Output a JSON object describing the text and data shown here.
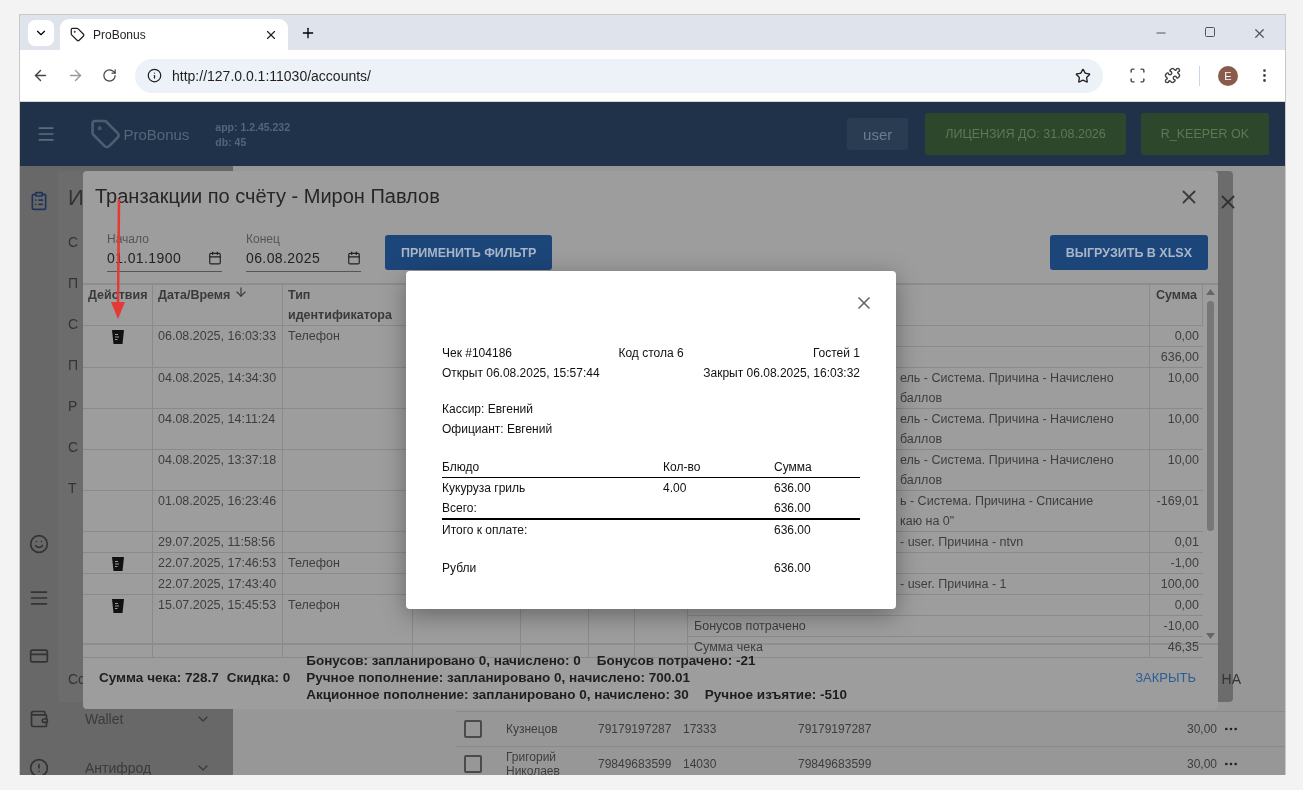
{
  "browser": {
    "tab_title": "ProBonus",
    "url": "http://127.0.0.1:11030/accounts/",
    "profile_initial": "E"
  },
  "header": {
    "brand": "ProBonus",
    "app_version": "app: 1.2.45.232",
    "db_version": "db: 45",
    "user": "user",
    "license": "ЛИЦЕНЗИЯ ДО: 31.08.2026",
    "rkeeper_status": "R_KEEPER OK"
  },
  "sidebar": {
    "items": [
      {
        "label": "Wallet",
        "expanded": false
      },
      {
        "label": "Антифрод",
        "expanded": false
      }
    ]
  },
  "background_table": {
    "rows": [
      {
        "checked": false,
        "name": "Кузнецов",
        "phone": "79179197287",
        "code": "17333",
        "card": "79179197287",
        "amount": "30,00"
      },
      {
        "checked": false,
        "name": "Григорий\nНиколаев",
        "phone": "79849683599",
        "code": "14030",
        "card": "79849683599",
        "amount": "30,00"
      }
    ]
  },
  "back_dialog": {
    "title_fragment": "И",
    "item_fragments": [
      "С",
      "П",
      "С",
      "П",
      "Р",
      "С",
      "Т"
    ],
    "footer_fragment": "Со",
    "footer_right_fragment": "НА"
  },
  "dialog": {
    "title": "Транзакции по счёту - Мирон Павлов",
    "filters": [
      {
        "label": "Начало",
        "value": "01.01.1900"
      },
      {
        "label": "Конец",
        "value": "06.08.2025"
      }
    ],
    "apply_button": "ПРИМЕНИТЬ ФИЛЬТР",
    "export_button": "ВЫГРУЗИТЬ В XLSX",
    "table": {
      "columns": [
        {
          "label": "Действия"
        },
        {
          "label": "Дата/Время",
          "sorted": true
        },
        {
          "label": "Тип идентификатора"
        },
        {
          "label": "Сумма"
        }
      ],
      "rows": [
        {
          "has_receipt": true,
          "date": "06.08.2025, 16:03:33",
          "id_type": "Телефон",
          "parts": [
            {
              "amount": "0,00"
            },
            {
              "amount": "636,00"
            }
          ]
        },
        {
          "has_receipt": false,
          "date": "04.08.2025, 14:34:30",
          "parts": [
            {
              "text": "ель - Система. Причина - Начислено\nбаллов",
              "amount": "10,00"
            }
          ]
        },
        {
          "has_receipt": false,
          "date": "04.08.2025, 14:11:24",
          "parts": [
            {
              "text": "ель - Система. Причина - Начислено\nбаллов",
              "amount": "10,00"
            }
          ]
        },
        {
          "has_receipt": false,
          "date": "04.08.2025, 13:37:18",
          "parts": [
            {
              "text": "ель - Система. Причина - Начислено\nбаллов",
              "amount": "10,00"
            }
          ]
        },
        {
          "has_receipt": false,
          "date": "01.08.2025, 16:23:46",
          "parts": [
            {
              "text": "ь - Система. Причина - Списание\nкаю на 0\"",
              "amount": "-169,01"
            }
          ]
        },
        {
          "has_receipt": false,
          "date": "29.07.2025, 11:58:56",
          "parts": [
            {
              "text": "- user. Причина - ntvn",
              "amount": "0,01"
            }
          ]
        },
        {
          "has_receipt": true,
          "date": "22.07.2025, 17:46:53",
          "id_type": "Телефон",
          "parts": [
            {
              "amount": "-1,00"
            }
          ]
        },
        {
          "has_receipt": false,
          "date": "22.07.2025, 17:43:40",
          "parts": [
            {
              "text": "- user. Причина - 1",
              "amount": "100,00"
            }
          ]
        },
        {
          "has_receipt": true,
          "date": "15.07.2025, 15:45:53",
          "id_type": "Телефон",
          "parts": [
            {
              "amount": "0,00"
            },
            {
              "text": "Бонусов потрачено",
              "amount": "-10,00"
            },
            {
              "text": "Сумма чека",
              "amount": "46,35"
            }
          ]
        }
      ]
    },
    "summary": {
      "totals": [
        "Сумма чека: 728.7",
        "Скидка: 0"
      ],
      "lines": [
        [
          "Бонусов: запланировано 0, начислено: 0",
          "Бонусов потрачено: -21"
        ],
        [
          "Ручное пополнение: запланировано 0, начислено: 700.01"
        ],
        [
          "Акционное пополнение: запланировано 0, начислено: 30",
          "Ручное изъятие: -510"
        ]
      ]
    },
    "close_button": "ЗАКРЫТЬ"
  },
  "receipt": {
    "check_number": "Чек #104186",
    "table_code": "Код стола 6",
    "guests": "Гостей 1",
    "opened": "Открыт 06.08.2025, 15:57:44",
    "closed": "Закрыт 06.08.2025, 16:03:32",
    "cashier": "Кассир: Евгений",
    "waiter": "Официант: Евгений",
    "columns": [
      "Блюдо",
      "Кол-во",
      "Сумма"
    ],
    "items": [
      {
        "name": "Кукуруза гриль",
        "qty": "4.00",
        "sum": "636.00"
      }
    ],
    "subtotal": {
      "label": "Всего:",
      "sum": "636.00"
    },
    "total": {
      "label": "Итого к оплате:",
      "sum": "636.00"
    },
    "payments": [
      {
        "label": "Рубли",
        "sum": "636.00"
      }
    ]
  }
}
